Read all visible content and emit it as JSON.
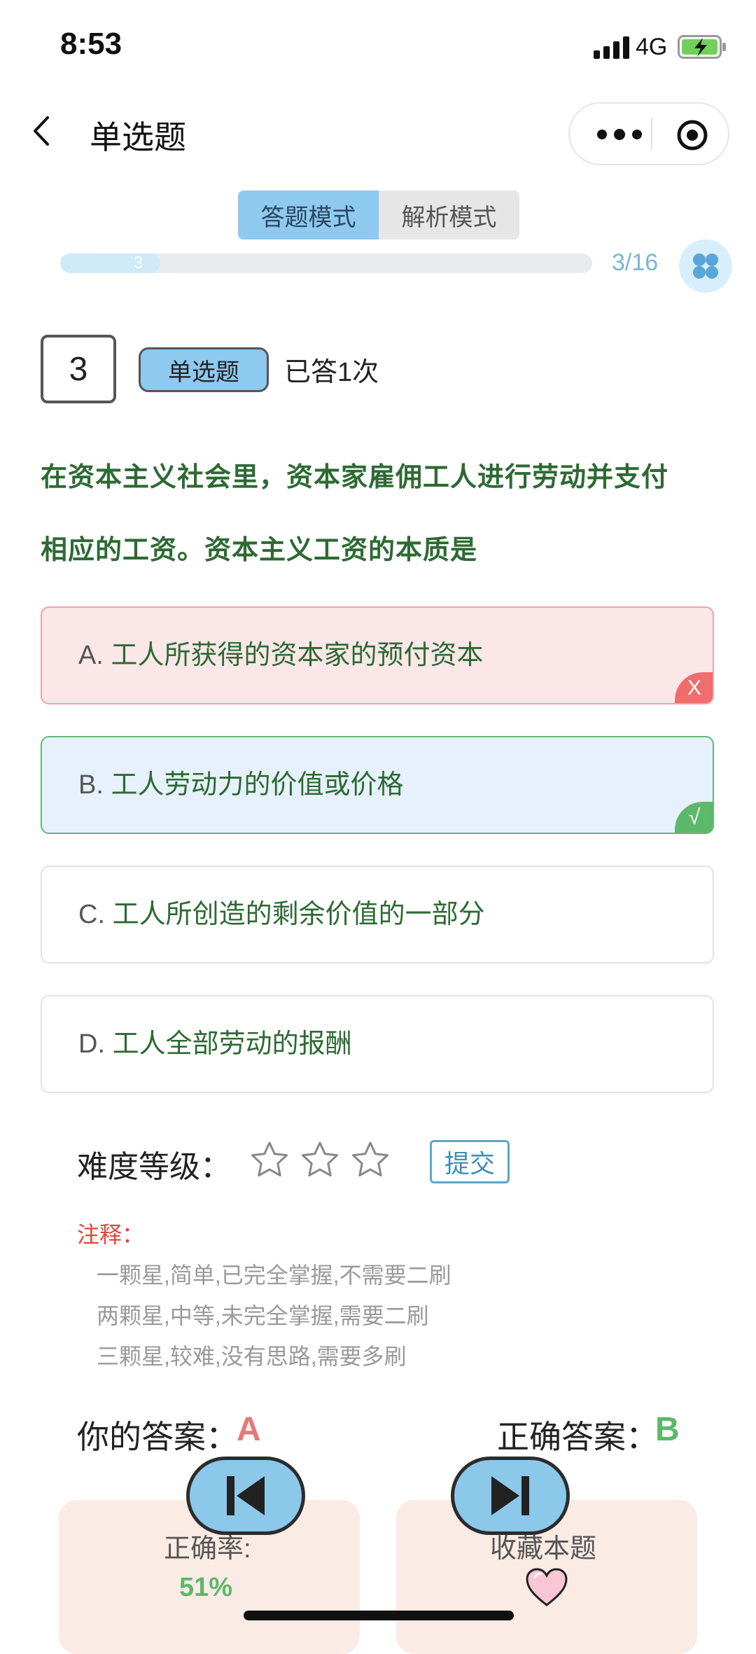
{
  "status_bar": {
    "time": "8:53",
    "network": "4G"
  },
  "nav": {
    "title": "单选题"
  },
  "modes": [
    {
      "label": "答题模式",
      "active": true
    },
    {
      "label": "解析模式",
      "active": false
    }
  ],
  "progress": {
    "current_label": "3",
    "count": "3/16",
    "fraction": 0.1875
  },
  "question": {
    "number": "3",
    "type": "单选题",
    "answered": "已答1次",
    "text_line1": "在资本主义社会里，资本家雇佣工人进行劳动并支付",
    "text_line2": "相应的工资。资本主义工资的本质是"
  },
  "options": [
    {
      "letter": "A.",
      "text": "工人所获得的资本家的预付资本",
      "mark": "X"
    },
    {
      "letter": "B.",
      "text": "工人劳动力的价值或价格",
      "mark": "√"
    },
    {
      "letter": "C.",
      "text": "工人所创造的剩余价值的一部分"
    },
    {
      "letter": "D.",
      "text": "工人全部劳动的报酬"
    }
  ],
  "difficulty": {
    "label": "难度等级：",
    "submit": "提交",
    "note_title": "注释：",
    "notes": [
      "一颗星,简单,已完全掌握,不需要二刷",
      "两颗星,中等,未完全掌握,需要二刷",
      "三颗星,较难,没有思路,需要多刷"
    ]
  },
  "answers": {
    "your_label": "你的答案：",
    "your_value": "A",
    "correct_label": "正确答案：",
    "correct_value": "B"
  },
  "stats": {
    "rate_label": "正确率:",
    "rate_value": "51%",
    "favorite_label": "收藏本题"
  },
  "colors": {
    "accent": "#8ec9ef",
    "correct": "#5cb86a",
    "wrong": "#ef6d6d",
    "question_text": "#2d6a33"
  }
}
